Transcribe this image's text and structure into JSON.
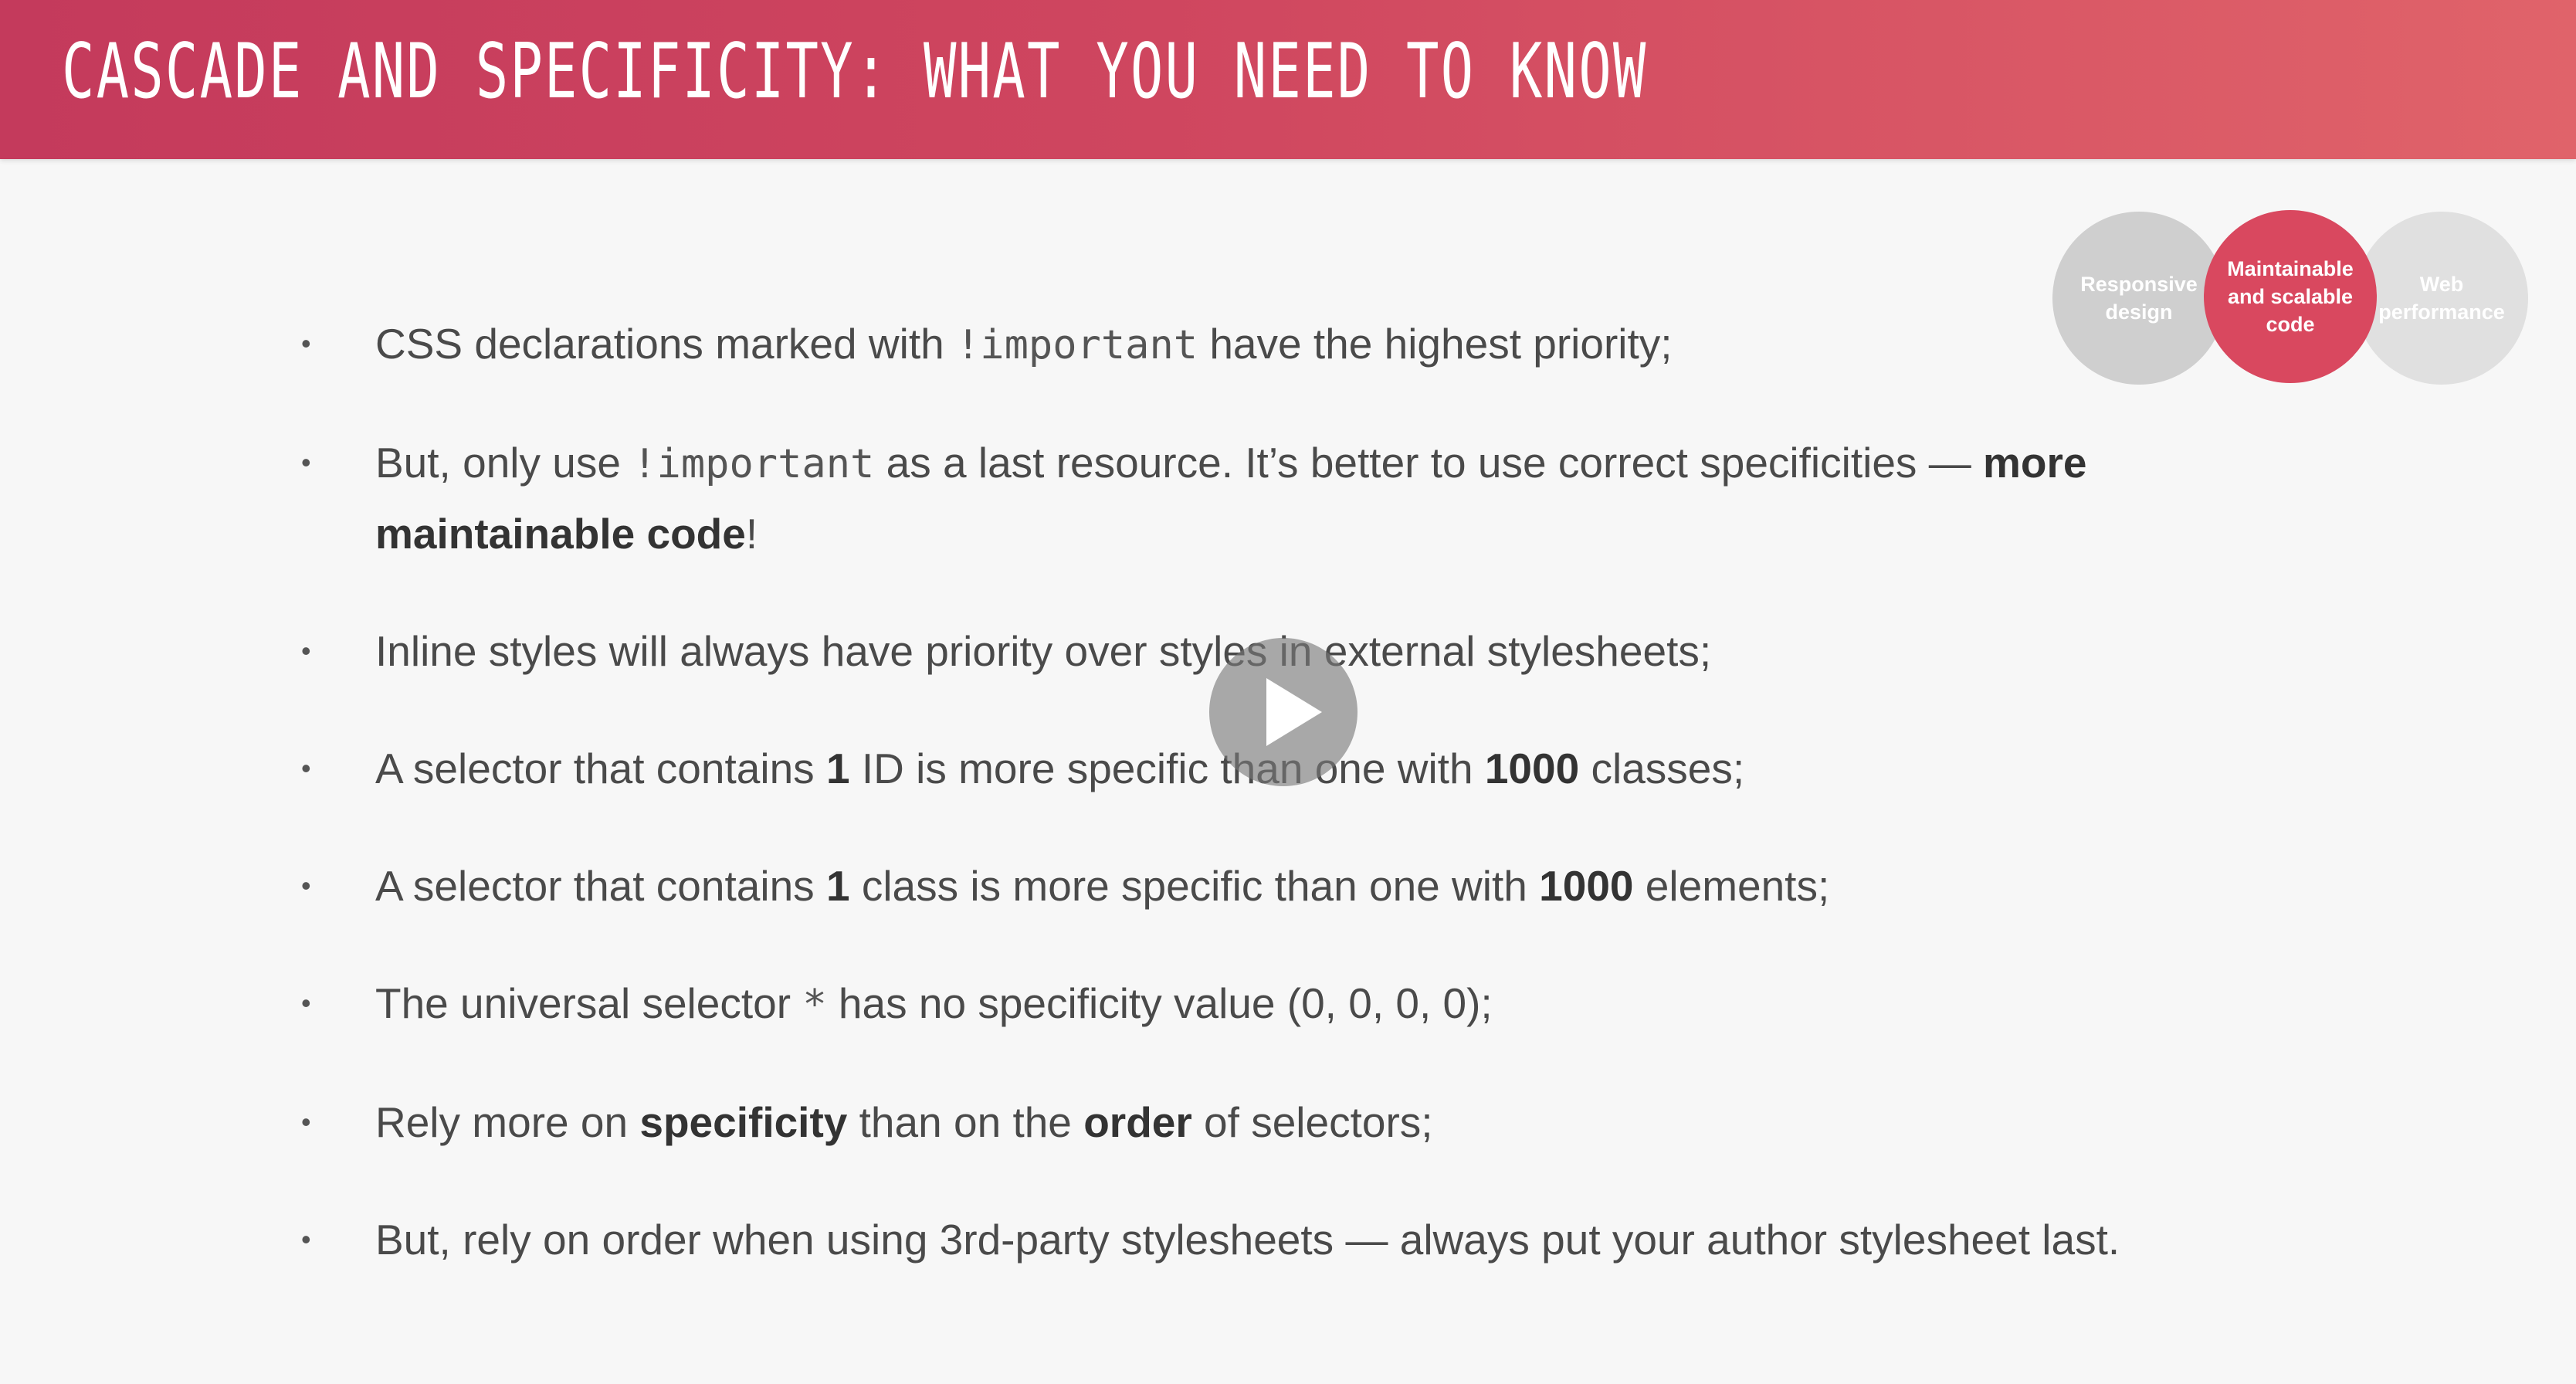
{
  "slide": {
    "title": "CASCADE AND SPECIFICITY: WHAT YOU NEED TO KNOW",
    "topic_circles": [
      {
        "label_line1": "Responsive",
        "label_line2": "design",
        "label_line3": "",
        "active": false
      },
      {
        "label_line1": "Maintainable",
        "label_line2": "and scalable",
        "label_line3": "code",
        "active": true
      },
      {
        "label_line1": "Web",
        "label_line2": "performance",
        "label_line3": "",
        "active": false
      }
    ],
    "colors": {
      "header_start": "#c43a5c",
      "header_end": "#e0636a",
      "active_circle": "#d9485f",
      "inactive_circle": "#cfcfcf"
    },
    "bullets": {
      "b1": {
        "t1": "CSS declarations marked with ",
        "code": "!important",
        "t2": " have the highest priority;"
      },
      "b2": {
        "t1": "But, only use ",
        "code": "!important",
        "t2": " as a last resource. It’s better to use correct specificities — ",
        "bold": "more maintainable code",
        "t3": "!"
      },
      "b3": {
        "t1": "Inline styles will always have priority over styles in external stylesheets;"
      },
      "b4": {
        "t1": "A selector that contains ",
        "bold1": "1",
        "t2": " ID is more specific than one with ",
        "bold2": "1000",
        "t3": " classes;"
      },
      "b5": {
        "t1": "A selector that contains ",
        "bold1": "1",
        "t2": " class is more specific than one with ",
        "bold2": "1000",
        "t3": " elements;"
      },
      "b6": {
        "t1": "The universal selector ",
        "code": "*",
        "t2": " has no specificity value (0, 0, 0, 0);"
      },
      "b7": {
        "t1": "Rely more on ",
        "bold1": "specificity",
        "t2": " than on the ",
        "bold2": "order",
        "t3": " of selectors;"
      },
      "b8": {
        "t1": "But, rely on order when using 3rd-party stylesheets — always put your author stylesheet last."
      }
    },
    "play_icon": "play-icon"
  }
}
